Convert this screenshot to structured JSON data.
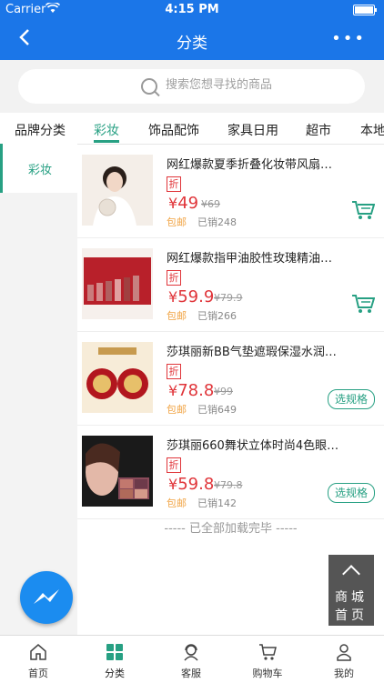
{
  "status_bar": {
    "carrier": "Carrier",
    "time": "4:15 PM"
  },
  "nav": {
    "title": "分类",
    "more": "•••"
  },
  "search": {
    "placeholder": "搜索您想寻找的商品"
  },
  "tabs": [
    "品牌分类",
    "彩妆",
    "饰品配饰",
    "家具日用",
    "超市",
    "本地"
  ],
  "active_tab": "彩妆",
  "sidebar": {
    "items": [
      "彩妆"
    ]
  },
  "products": [
    {
      "name": "网红爆款夏季折叠化妆带风扇…",
      "badge": "折",
      "currency": "¥",
      "price": "49",
      "old_price": "¥69",
      "shipping": "包邮",
      "sold": "已销248",
      "action": "cart"
    },
    {
      "name": "网红爆款指甲油胶性玫瑰精油…",
      "badge": "折",
      "currency": "¥",
      "price": "59.9",
      "old_price": "¥79.9",
      "shipping": "包邮",
      "sold": "已销266",
      "action": "cart"
    },
    {
      "name": "莎琪丽新BB气垫遮瑕保湿水润…",
      "badge": "折",
      "currency": "¥",
      "price": "78.8",
      "old_price": "¥99",
      "shipping": "包邮",
      "sold": "已销649",
      "action": "选规格"
    },
    {
      "name": "莎琪丽660舞状立体时尚4色眼…",
      "badge": "折",
      "currency": "¥",
      "price": "59.8",
      "old_price": "¥79.8",
      "shipping": "包邮",
      "sold": "已销142",
      "action": "选规格"
    }
  ],
  "end_text": "----- 已全部加载完毕 -----",
  "back_to_home": {
    "line1": "商城",
    "line2": "首页"
  },
  "tabbar": [
    "首页",
    "分类",
    "客服",
    "购物车",
    "我的"
  ],
  "active_tabbar": "分类",
  "colors": {
    "primary_blue": "#1b76e8",
    "accent_green": "#27a083",
    "price_red": "#e0353a",
    "ship_orange": "#f1a444"
  }
}
